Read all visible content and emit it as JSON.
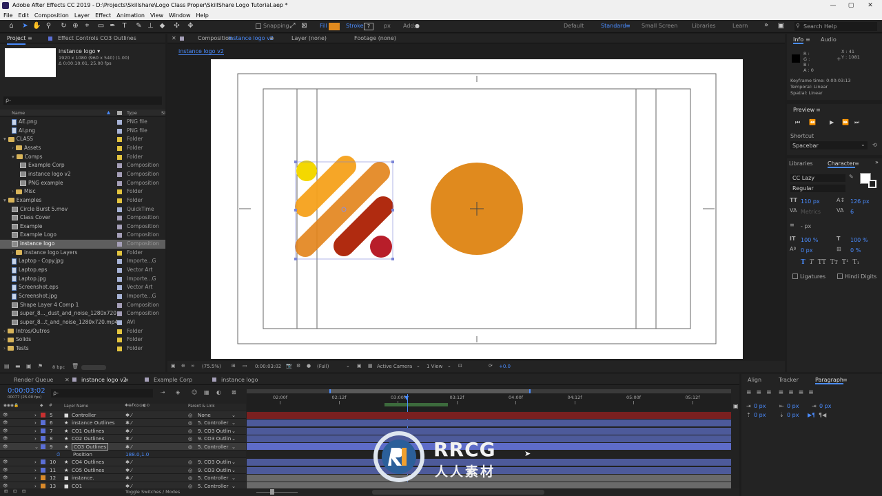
{
  "title": "Adobe After Effects CC 2019 - D:\\Projects\\Skillshare\\Logo Class Proper\\SkillShare Logo Tutorial.aep *",
  "window_buttons": [
    "—",
    "▢",
    "✕"
  ],
  "menu": [
    "File",
    "Edit",
    "Composition",
    "Layer",
    "Effect",
    "Animation",
    "View",
    "Window",
    "Help"
  ],
  "toolbar": {
    "snapping": "Snapping",
    "fill": "Fill",
    "stroke": "Stroke",
    "stroke_value": "?",
    "px": "px",
    "add": "Add:",
    "workspaces": [
      "Default",
      "Standard",
      "Small Screen",
      "Libraries",
      "Learn"
    ],
    "search_placeholder": "Search Help",
    "more": "»",
    "fill_color": "#e08a1e"
  },
  "project": {
    "tab": "Project",
    "tab2": "Effect Controls CO3 Outlines",
    "item_name": "instance logo ▾",
    "item_size": "1920 x 1080  (960 x 540) (1.00)",
    "item_duration": "Δ 0:00:10:01, 25.00 fps",
    "search_placeholder": "ρ-",
    "col_name": "Name",
    "col_type": "Type",
    "col_size": "Si",
    "items": [
      {
        "name": "AE.png",
        "type": "PNG file",
        "kind": "image",
        "indent": 1,
        "label": "#a7b3d6"
      },
      {
        "name": "AI.png",
        "type": "PNG file",
        "kind": "image",
        "indent": 1,
        "label": "#a7b3d6"
      },
      {
        "name": "CLASS",
        "type": "Folder",
        "kind": "folder",
        "indent": 0,
        "label": "#e3c43f",
        "arrow": "▾"
      },
      {
        "name": "Assets",
        "type": "Folder",
        "kind": "folder",
        "indent": 1,
        "label": "#e3c43f",
        "arrow": "›"
      },
      {
        "name": "Comps",
        "type": "Folder",
        "kind": "folder",
        "indent": 1,
        "label": "#e3c43f",
        "arrow": "▾"
      },
      {
        "name": "Example Corp",
        "type": "Composition",
        "kind": "comp",
        "indent": 2,
        "label": "#a59fb8"
      },
      {
        "name": "instance logo v2",
        "type": "Composition",
        "kind": "comp",
        "indent": 2,
        "label": "#a59fb8"
      },
      {
        "name": "PNG example",
        "type": "Composition",
        "kind": "comp",
        "indent": 2,
        "label": "#a59fb8"
      },
      {
        "name": "Misc",
        "type": "Folder",
        "kind": "folder",
        "indent": 1,
        "label": "#e3c43f",
        "arrow": "›"
      },
      {
        "name": "Examples",
        "type": "Folder",
        "kind": "folder",
        "indent": 0,
        "label": "#e3c43f",
        "arrow": "▾"
      },
      {
        "name": "Circle Burst 5.mov",
        "type": "QuickTime",
        "kind": "comp",
        "indent": 1,
        "label": "#a7b3d6"
      },
      {
        "name": "Class Cover",
        "type": "Composition",
        "kind": "comp",
        "indent": 1,
        "label": "#a59fb8"
      },
      {
        "name": "Example",
        "type": "Composition",
        "kind": "comp",
        "indent": 1,
        "label": "#a59fb8"
      },
      {
        "name": "Example Logo",
        "type": "Composition",
        "kind": "comp",
        "indent": 1,
        "label": "#a59fb8"
      },
      {
        "name": "instance logo",
        "type": "Composition",
        "kind": "comp",
        "indent": 1,
        "label": "#a59fb8",
        "selected": true
      },
      {
        "name": "instance logo Layers",
        "type": "Folder",
        "kind": "folder",
        "indent": 1,
        "label": "#e3c43f",
        "arrow": "›"
      },
      {
        "name": "Laptop - Copy.jpg",
        "type": "Importe...G",
        "kind": "image",
        "indent": 1,
        "label": "#a7b3d6"
      },
      {
        "name": "Laptop.eps",
        "type": "Vector Art",
        "kind": "image",
        "indent": 1,
        "label": "#a7b3d6"
      },
      {
        "name": "Laptop.jpg",
        "type": "Importe...G",
        "kind": "image",
        "indent": 1,
        "label": "#a7b3d6"
      },
      {
        "name": "Screenshot.eps",
        "type": "Vector Art",
        "kind": "image",
        "indent": 1,
        "label": "#a7b3d6"
      },
      {
        "name": "Screenshot.jpg",
        "type": "Importe...G",
        "kind": "image",
        "indent": 1,
        "label": "#a7b3d6"
      },
      {
        "name": "Shape Layer 4 Comp 1",
        "type": "Composition",
        "kind": "comp",
        "indent": 1,
        "label": "#a59fb8"
      },
      {
        "name": "super_8..._dust_and_noise_1280x720",
        "type": "Composition",
        "kind": "comp",
        "indent": 1,
        "label": "#a59fb8"
      },
      {
        "name": "super_8...t_and_noise_1280x720.mp4",
        "type": "AVI",
        "kind": "comp",
        "indent": 1,
        "label": "#a7b3d6"
      },
      {
        "name": "Intros/Outros",
        "type": "Folder",
        "kind": "folder",
        "indent": 0,
        "label": "#e3c43f",
        "arrow": "›"
      },
      {
        "name": "Solids",
        "type": "Folder",
        "kind": "folder",
        "indent": 0,
        "label": "#e3c43f",
        "arrow": "›"
      },
      {
        "name": "Tests",
        "type": "Folder",
        "kind": "folder",
        "indent": 0,
        "label": "#e3c43f",
        "arrow": "›"
      }
    ],
    "bpc": "8 bpc"
  },
  "comp": {
    "tab_prefix": "Composition",
    "tab_name": "instance logo v2",
    "layer_tab": "Layer (none)",
    "footage_tab": "Footage (none)",
    "sub_tab": "instance logo v2",
    "zoom": "(75.5%)",
    "timecode": "0:00:03:02",
    "resolution": "(Full)",
    "camera": "Active Camera",
    "view": "1 View",
    "exposure": "+0.0"
  },
  "info": {
    "tab": "Info",
    "audio_tab": "Audio",
    "r": "R :",
    "g": "G :",
    "b": "B :",
    "a": "A : 0",
    "x": "X : 41",
    "y": "Y : 1081",
    "keyframe_time": "Keyframe time: 0:00:03:13",
    "temporal": "Temporal: Linear",
    "spatial": "Spatial: Linear"
  },
  "preview": {
    "tab": "Preview",
    "shortcut_label": "Shortcut",
    "shortcut": "Spacebar"
  },
  "character": {
    "libraries_tab": "Libraries",
    "tab": "Character",
    "font": "CC Lazy",
    "style": "Regular",
    "size": "110 px",
    "leading": "126 px",
    "kerning": "Metrics",
    "tracking": "6",
    "stroke_px": "- px",
    "vscale": "100 %",
    "hscale": "100 %",
    "baseline": "0 px",
    "tsume": "0 %",
    "styles": [
      "T",
      "T",
      "TT",
      "Tт",
      "T¹",
      "T₁"
    ],
    "ligatures": "Ligatures",
    "hindi": "Hindi Digits"
  },
  "timeline": {
    "render_queue": "Render Queue",
    "tab1": "instance logo v2",
    "tab2": "Example Corp",
    "tab3": "instance logo",
    "current_time": "0:00:03:02",
    "fps_info": "00077 (25.00 fps)",
    "search_placeholder": "ρ-",
    "col_layer": "Layer Name",
    "col_parent": "Parent & Link",
    "ruler": [
      "02:00f",
      "02:12f",
      "03:00f",
      "03:12f",
      "04:00f",
      "04:12f",
      "05:00f",
      "05:12f"
    ],
    "layers": [
      {
        "num": "5",
        "name": "Controller",
        "parent": "None",
        "label": "#c83030",
        "bar": "#7a2020",
        "star": false,
        "box": true
      },
      {
        "num": "6",
        "name": "instance Outlines",
        "parent": "5. Controller",
        "label": "#5b6fd6",
        "bar": "#4d5a9a",
        "star": true
      },
      {
        "num": "7",
        "name": "CO1 Outlines",
        "parent": "9. CO3 Outlin",
        "label": "#5b6fd6",
        "bar": "#4d5a9a",
        "star": true
      },
      {
        "num": "8",
        "name": "CO2 Outlines",
        "parent": "9. CO3 Outlin",
        "label": "#5b6fd6",
        "bar": "#4d5a9a",
        "star": true
      },
      {
        "num": "9",
        "name": "CO3 Outlines",
        "parent": "5. Controller",
        "label": "#5b6fd6",
        "bar": "#5e6cc8",
        "star": true,
        "selected": true
      },
      {
        "num": "",
        "name": "Position",
        "parent": "",
        "value": "188.0,1.0",
        "label": "",
        "bar": "",
        "prop": true
      },
      {
        "num": "10",
        "name": "CO4 Outlines",
        "parent": "9. CO3 Outlin",
        "label": "#5b6fd6",
        "bar": "#4d5a9a",
        "star": true
      },
      {
        "num": "11",
        "name": "CO5 Outlines",
        "parent": "9. CO3 Outlin",
        "label": "#5b6fd6",
        "bar": "#4d5a9a",
        "star": true
      },
      {
        "num": "12",
        "name": "instance.",
        "parent": "5. Controller",
        "label": "#d98a2a",
        "bar": "#6a6a6a",
        "star": false
      },
      {
        "num": "13",
        "name": "CO1",
        "parent": "5. Controller",
        "label": "#d98a2a",
        "bar": "#6a6a6a",
        "star": false
      }
    ],
    "toggle": "Toggle Switches / Modes"
  },
  "paragraph": {
    "align_tab": "Align",
    "tracker_tab": "Tracker",
    "tab": "Paragraph",
    "v1": "0 px",
    "v2": "0 px",
    "v3": "0 px",
    "v4": "0 px",
    "v5": "0 px"
  },
  "watermark": {
    "brand": "RRCG",
    "sub": "人人素材"
  }
}
